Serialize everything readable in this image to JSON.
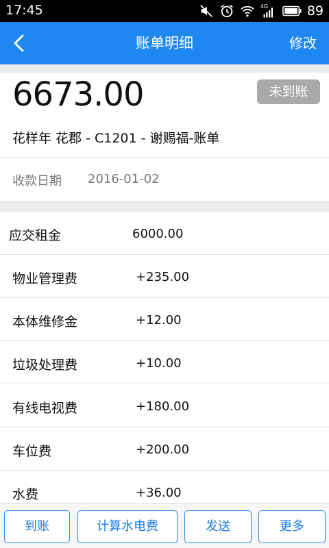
{
  "status_bar": {
    "time": "17:45",
    "network_badge": "4G",
    "battery": "89",
    "icons": [
      "mute-icon",
      "alarm-icon",
      "wifi-icon",
      "signal-icon",
      "battery-icon"
    ]
  },
  "header": {
    "back_icon": "chevron-left-icon",
    "title": "账单明细",
    "edit_label": "修改",
    "color": "#1e88f0"
  },
  "summary": {
    "amount": "6673.00",
    "status": "未到账",
    "bill_name": "花样年 花郡 - C1201 - 谢赐福-账单",
    "date_label": "收款日期",
    "date_value": "2016-01-02"
  },
  "fees": [
    {
      "label": "应交租金",
      "value": "6000.00"
    },
    {
      "label": "物业管理费",
      "value": "+235.00"
    },
    {
      "label": "本体维修金",
      "value": "+12.00"
    },
    {
      "label": "垃圾处理费",
      "value": "+10.00"
    },
    {
      "label": "有线电视费",
      "value": "+180.00"
    },
    {
      "label": "车位费",
      "value": "+200.00"
    },
    {
      "label": "水费",
      "value": "+36.00"
    }
  ],
  "actions": {
    "received": "到账",
    "calc_utilities": "计算水电费",
    "send": "发送",
    "more": "更多"
  }
}
